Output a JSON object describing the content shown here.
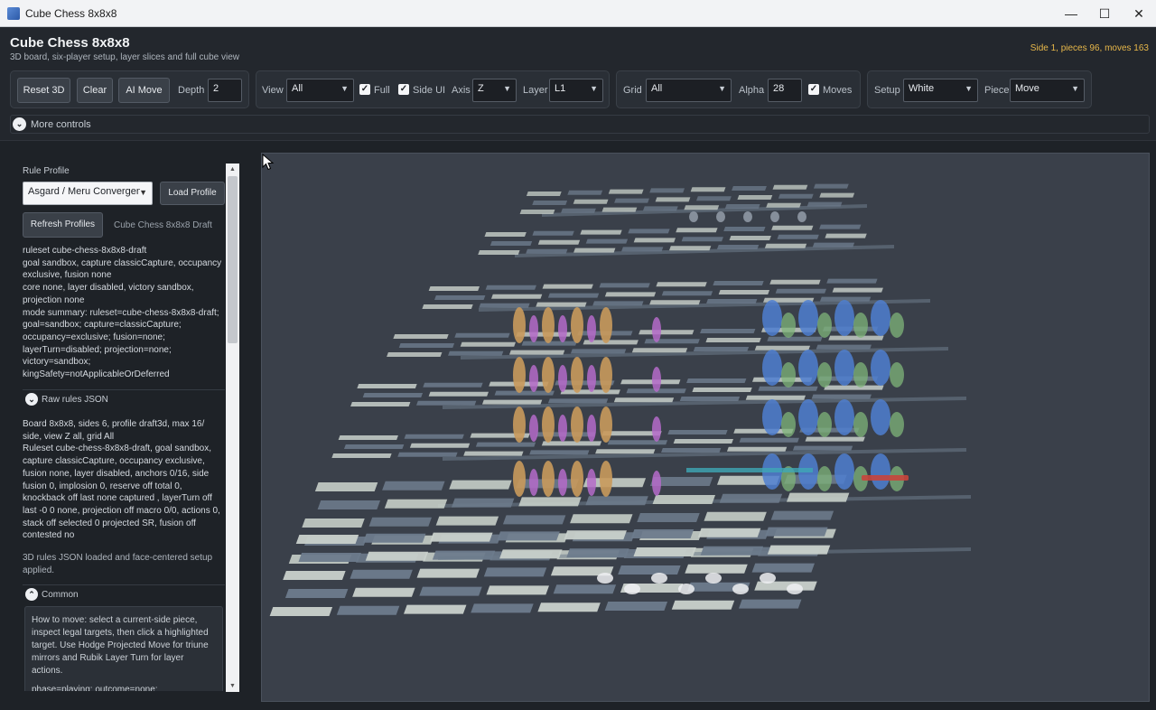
{
  "window": {
    "title": "Cube Chess 8x8x8",
    "minimize": "—",
    "maximize": "☐",
    "close": "✕"
  },
  "header": {
    "title": "Cube Chess 8x8x8",
    "subtitle": "3D board, six-player setup, layer slices and full cube view",
    "status": "Side 1, pieces 96, moves 163"
  },
  "toolbar": {
    "reset": "Reset 3D",
    "clear": "Clear",
    "ai_move": "AI Move",
    "depth_label": "Depth",
    "depth_value": "2",
    "view_label": "View",
    "view_value": "All",
    "full_label": "Full",
    "full_checked": true,
    "side_ui_label": "Side UI",
    "side_ui_checked": true,
    "axis_label": "Axis",
    "axis_value": "Z",
    "layer_label": "Layer",
    "layer_value": "L1",
    "grid_label": "Grid",
    "grid_value": "All",
    "alpha_label": "Alpha",
    "alpha_value": "28",
    "moves_label": "Moves",
    "moves_checked": true,
    "setup_label": "Setup",
    "setup_value": "White",
    "piece_label": "Piece",
    "piece_value": "Move",
    "more_controls": "More controls"
  },
  "sidebar": {
    "rule_profile_label": "Rule Profile",
    "profile_value": "Asgard / Meru Convergenc",
    "load_profile": "Load Profile",
    "refresh_profiles": "Refresh Profiles",
    "profile_name": "Cube Chess 8x8x8 Draft",
    "ruleset_text": "ruleset cube-chess-8x8x8-draft\ngoal sandbox, capture classicCapture, occupancy exclusive, fusion none\ncore none, layer disabled, victory sandbox, projection none\nmode summary: ruleset=cube-chess-8x8x8-draft; goal=sandbox; capture=classicCapture; occupancy=exclusive; fusion=none; layerTurn=disabled; projection=none; victory=sandbox; kingSafety=notApplicableOrDeferred",
    "raw_rules_label": "Raw rules JSON",
    "board_text": "Board 8x8x8, sides 6, profile draft3d, max 16/ side, view Z all, grid All\nRuleset cube-chess-8x8x8-draft, goal sandbox, capture classicCapture, occupancy exclusive, fusion none, layer disabled, anchors 0/16, side fusion 0, implosion 0, reserve off total 0, knockback off last none captured , layerTurn off last -0 0 none, projection off macro 0/0, actions 0, stack off selected 0 projected SR, fusion off contested no",
    "loaded_text": "3D rules JSON loaded and face-centered setup applied.",
    "common_label": "Common",
    "help_text": "How to move: select a current-side piece, inspect legal targets, then click a highlighted target. Use Hodge Projected Move for triune mirrors and Rubik Layer Turn for layer actions.",
    "phase_text": "phase=playing; outcome=none;"
  },
  "colors": {
    "accent_status": "#e8b84a",
    "viewport_bg": "#3a404a",
    "tile_light": "#c9d1cb",
    "tile_dark": "#6d7b8c",
    "piece_orange": "#c99a5c",
    "piece_violet": "#b56bc9",
    "piece_blue": "#4f7fd0",
    "piece_green": "#7fb47a",
    "piece_white": "#eef0f2",
    "move_cyan": "#3ea7b5",
    "move_red": "#c8453c"
  }
}
